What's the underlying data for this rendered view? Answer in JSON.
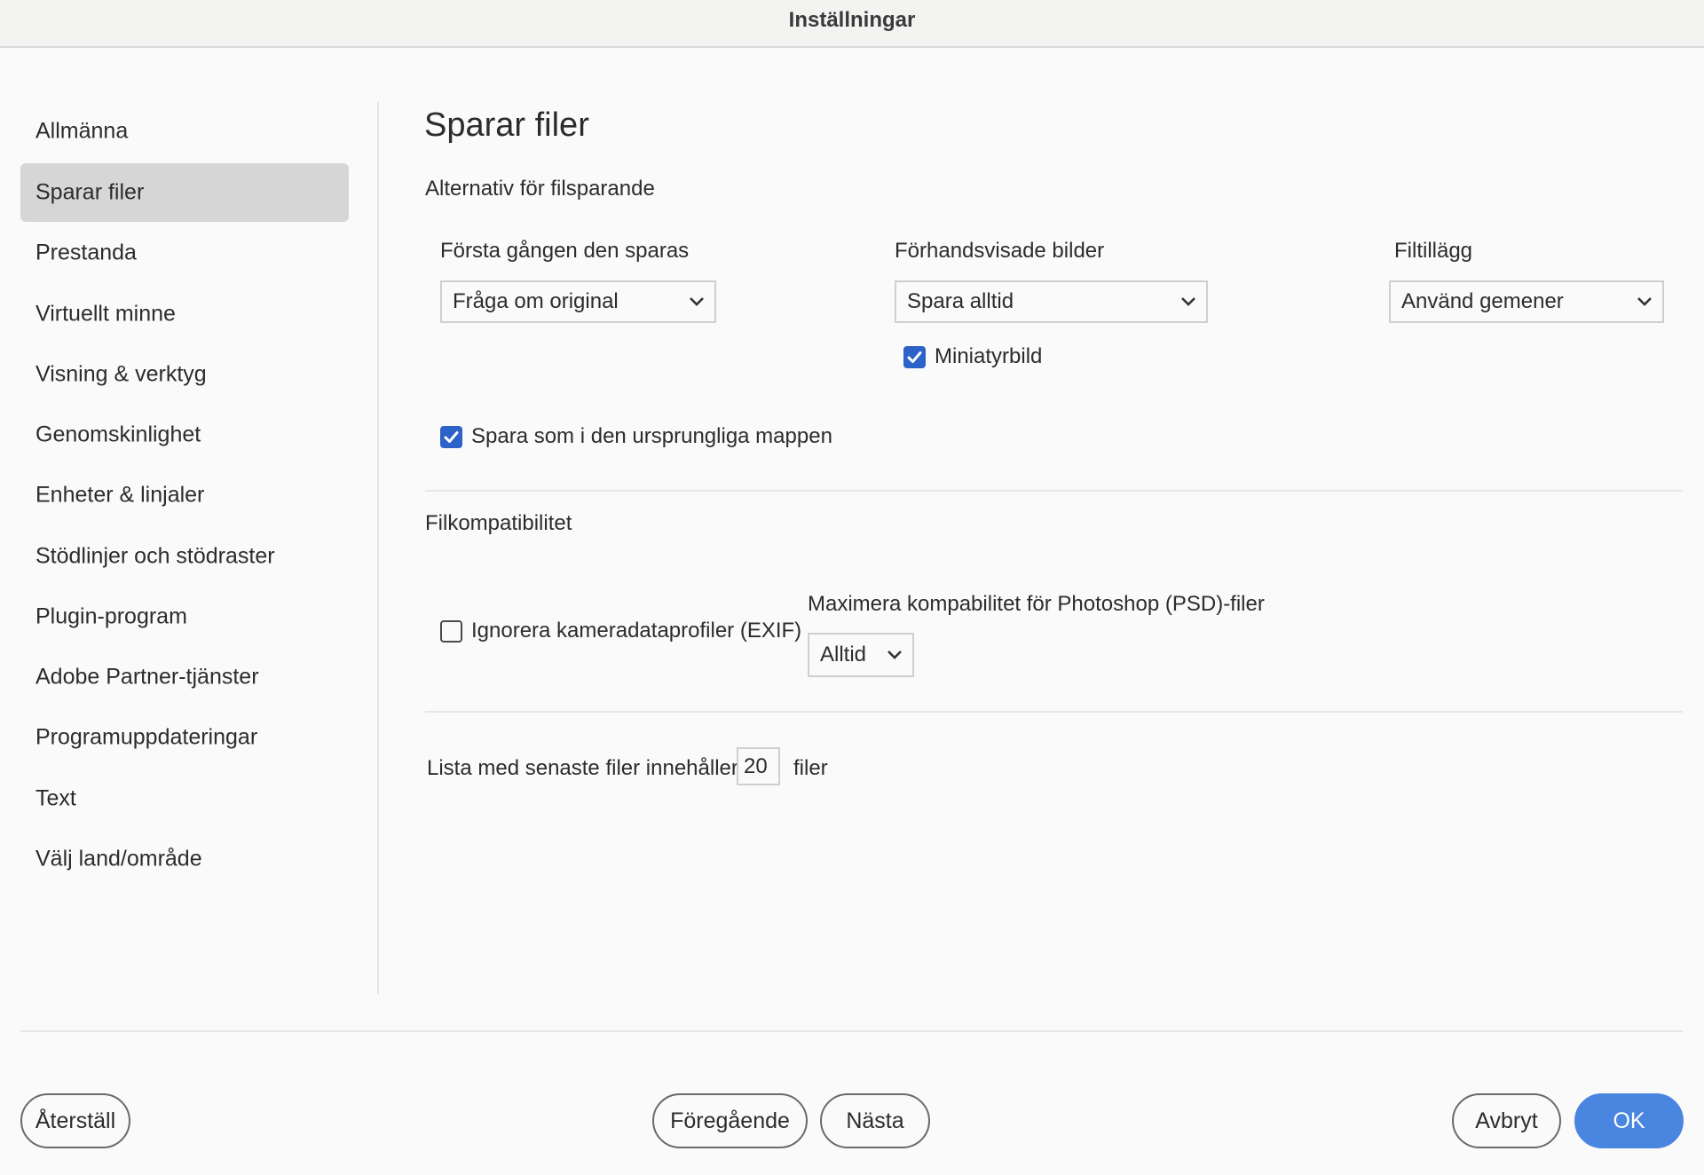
{
  "window": {
    "title": "Inställningar"
  },
  "sidebar": {
    "items": [
      {
        "label": "Allmänna",
        "selected": false
      },
      {
        "label": "Sparar filer",
        "selected": true
      },
      {
        "label": "Prestanda",
        "selected": false
      },
      {
        "label": "Virtuellt minne",
        "selected": false
      },
      {
        "label": "Visning & verktyg",
        "selected": false
      },
      {
        "label": "Genomskinlighet",
        "selected": false
      },
      {
        "label": "Enheter & linjaler",
        "selected": false
      },
      {
        "label": "Stödlinjer och stödraster",
        "selected": false
      },
      {
        "label": "Plugin-program",
        "selected": false
      },
      {
        "label": "Adobe Partner-tjänster",
        "selected": false
      },
      {
        "label": "Programuppdateringar",
        "selected": false
      },
      {
        "label": "Text",
        "selected": false
      },
      {
        "label": "Välj land/område",
        "selected": false
      }
    ]
  },
  "main": {
    "heading": "Sparar filer",
    "save_options": {
      "section_title": "Alternativ för filsparande",
      "first_save": {
        "label": "Första gången den sparas",
        "value": "Fråga om original"
      },
      "previews": {
        "label": "Förhandsvisade bilder",
        "value": "Spara alltid"
      },
      "thumbnail": {
        "label": "Miniatyrbild",
        "checked": true
      },
      "extension": {
        "label": "Filtillägg",
        "value": "Använd gemener"
      },
      "save_as_original_folder": {
        "label": "Spara som i den ursprungliga mappen",
        "checked": true
      }
    },
    "compatibility": {
      "section_title": "Filkompatibilitet",
      "ignore_exif": {
        "label": "Ignorera kameradataprofiler (EXIF)",
        "checked": false
      },
      "maximize_psd": {
        "label": "Maximera kompabilitet för Photoshop (PSD)-filer",
        "value": "Alltid"
      }
    },
    "recent_files": {
      "prefix": "Lista med senaste filer innehåller",
      "value": "20",
      "suffix": "filer"
    }
  },
  "footer": {
    "reset": "Återställ",
    "previous": "Föregående",
    "next": "Nästa",
    "cancel": "Avbryt",
    "ok": "OK"
  },
  "colors": {
    "accent": "#4a86e0",
    "checkbox": "#2d62c8",
    "selected_bg": "#d6d6d6"
  }
}
